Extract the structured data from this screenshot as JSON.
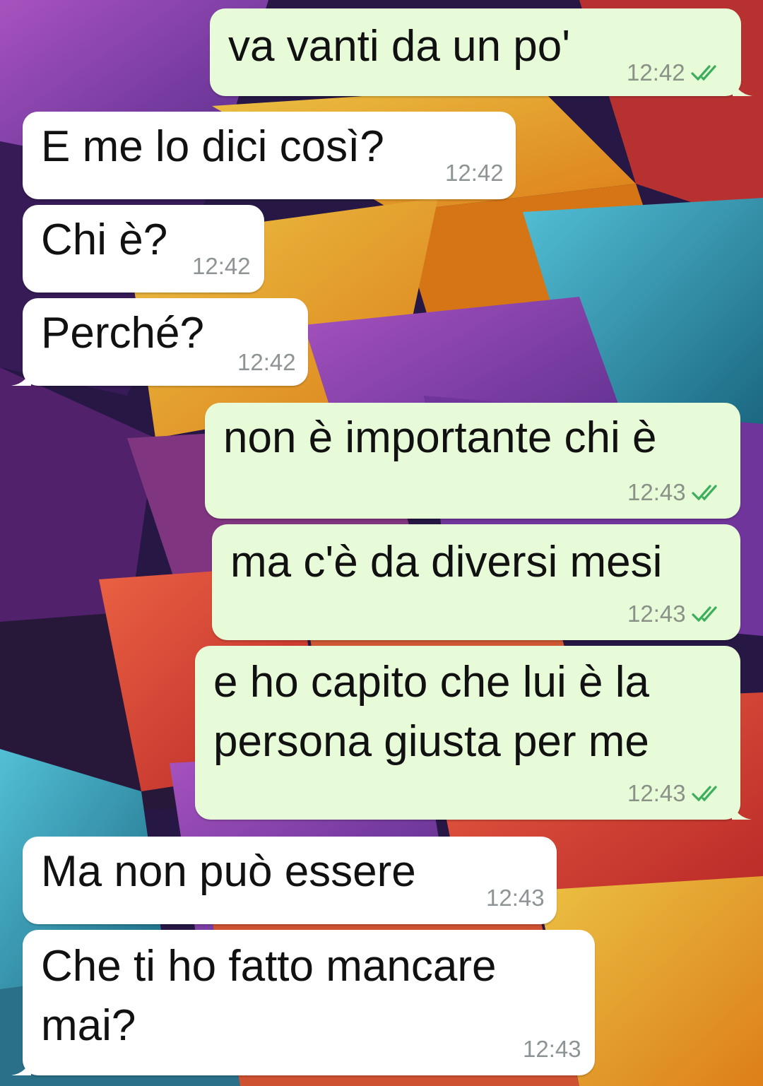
{
  "chat": {
    "tick_color": "#3cae5c",
    "outgoing_bg": "#e7fbd9",
    "incoming_bg": "#ffffff",
    "messages": [
      {
        "dir": "out",
        "lines": [
          "va vanti da un po'"
        ],
        "time": "12:42",
        "status": "read-double-check-icon"
      },
      {
        "dir": "in",
        "lines": [
          "E me lo dici così?"
        ],
        "time": "12:42"
      },
      {
        "dir": "in",
        "lines": [
          "Chi è?"
        ],
        "time": "12:42"
      },
      {
        "dir": "in",
        "lines": [
          "Perché?"
        ],
        "time": "12:42"
      },
      {
        "dir": "out",
        "lines": [
          "non è importante chi è"
        ],
        "time": "12:43",
        "status": "read-double-check-icon"
      },
      {
        "dir": "out",
        "lines": [
          "ma c'è da diversi mesi"
        ],
        "time": "12:43",
        "status": "read-double-check-icon"
      },
      {
        "dir": "out",
        "lines": [
          "e ho capito che lui è la",
          "persona giusta per me"
        ],
        "time": "12:43",
        "status": "read-double-check-icon"
      },
      {
        "dir": "in",
        "lines": [
          "Ma non può essere"
        ],
        "time": "12:43"
      },
      {
        "dir": "in",
        "lines": [
          "Che ti ho fatto mancare",
          "mai?"
        ],
        "time": "12:43"
      }
    ]
  }
}
